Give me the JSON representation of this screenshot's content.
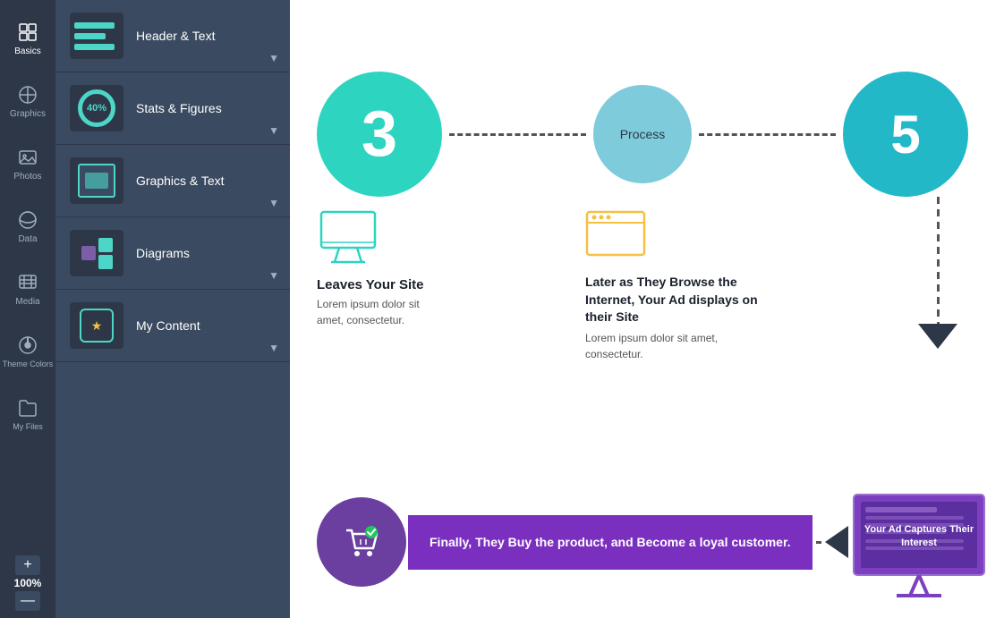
{
  "iconSidebar": {
    "items": [
      {
        "id": "basics",
        "label": "Basics",
        "active": true
      },
      {
        "id": "graphics",
        "label": "Graphics",
        "active": false
      },
      {
        "id": "photos",
        "label": "Photos",
        "active": false
      },
      {
        "id": "data",
        "label": "Data",
        "active": false
      },
      {
        "id": "media",
        "label": "Media",
        "active": false
      },
      {
        "id": "themecolors",
        "label": "Theme Colors",
        "active": false
      },
      {
        "id": "myfiles",
        "label": "My Files",
        "active": false
      }
    ],
    "zoomIn": "+",
    "zoomLevel": "100%",
    "zoomOut": "—"
  },
  "panelSidebar": {
    "items": [
      {
        "id": "header-text",
        "label": "Header & Text",
        "thumbType": "header"
      },
      {
        "id": "stats-figures",
        "label": "Stats & Figures",
        "thumbType": "stats",
        "percent": "40%"
      },
      {
        "id": "graphics-text",
        "label": "Graphics & Text",
        "thumbType": "graphic"
      },
      {
        "id": "diagrams",
        "label": "Diagrams",
        "thumbType": "diagrams"
      },
      {
        "id": "my-content",
        "label": "My Content",
        "thumbType": "mycontent"
      }
    ]
  },
  "infographic": {
    "step1": {
      "number": "3",
      "color": "#2dd4bf"
    },
    "step2": {
      "label": "Process",
      "color": "#7ecbdc"
    },
    "step3": {
      "number": "5",
      "color": "#22b8c8"
    },
    "card1": {
      "iconColor": "#2dd4bf",
      "title": "Leaves Your Site",
      "body": "Lorem ipsum dolor sit amet, consectetur."
    },
    "card2": {
      "iconColor": "#f6c042",
      "title": "Later as They Browse the Internet, Your Ad displays on their Site",
      "body": "Lorem ipsum dolor sit amet, consectetur."
    },
    "cta": {
      "circleColor": "#6b3fa0",
      "badgeText": "Finally, They Buy the product, and Become a loyal customer.",
      "badgeColor": "#7b2fbf"
    },
    "adCaptures": {
      "title": "Your Ad Captures Their Interest",
      "monitorColor": "#7b3fbf"
    }
  }
}
